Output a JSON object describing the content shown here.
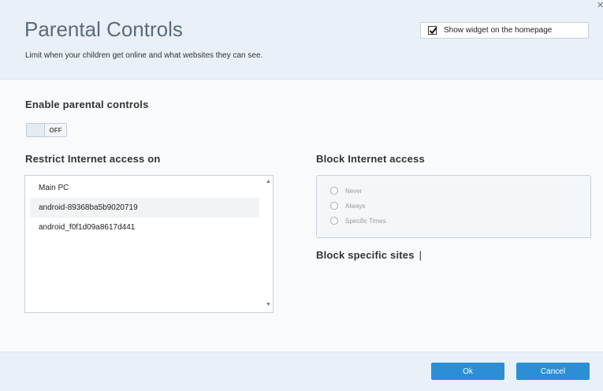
{
  "header": {
    "title": "Parental Controls",
    "subtitle": "Limit when your children get online and what websites they can see.",
    "widget_label": "Show widget on the homepage",
    "widget_checked": true,
    "close_glyph": "✕"
  },
  "enable": {
    "title": "Enable parental controls",
    "toggle_state": "OFF"
  },
  "restrict": {
    "title": "Restrict Internet access on",
    "devices": [
      "Main PC",
      "android-89368ba5b9020719",
      "android_f0f1d09a8617d441"
    ],
    "selected_index": 1
  },
  "block": {
    "title": "Block Internet access",
    "options": [
      "Never",
      "Always",
      "Specific Times"
    ]
  },
  "sites": {
    "title": "Block specific sites",
    "cursor": "|"
  },
  "footer": {
    "ok_label": "Ok",
    "cancel_label": "Cancel"
  },
  "colors": {
    "accent": "#2c8fd6",
    "header_bg": "#e9f0f7"
  }
}
